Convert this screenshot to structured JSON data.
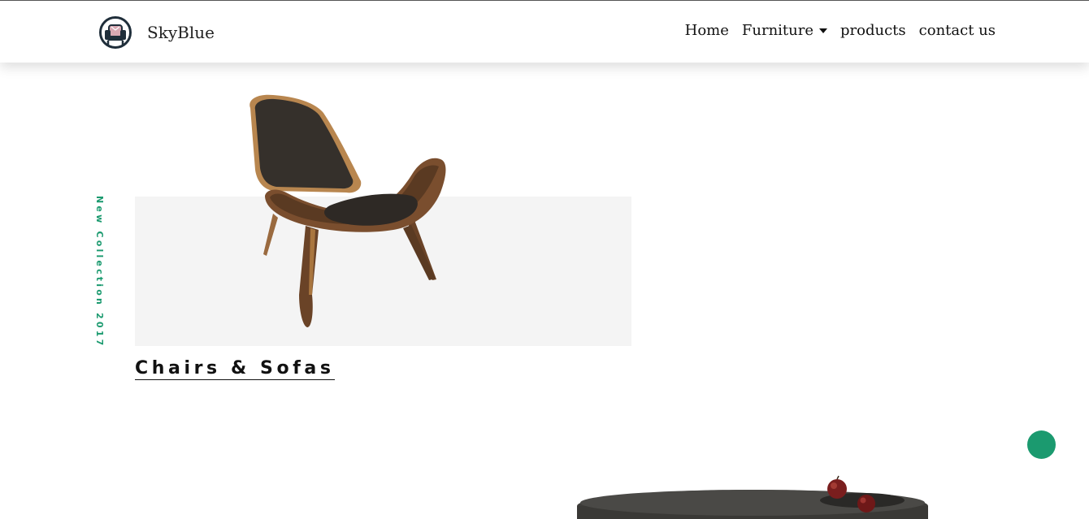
{
  "navbar": {
    "brand_name": "SkyBlue",
    "brand_icon": "armchair-logo-icon",
    "links": [
      {
        "label": "Home"
      },
      {
        "label": "Furniture",
        "has_dropdown": true
      },
      {
        "label": "products"
      },
      {
        "label": "contact us"
      }
    ]
  },
  "hero": {
    "vertical_caption": "New Collection 2017",
    "category_title": "Chairs & Sofas",
    "accent_color": "#1b9a6f"
  },
  "scroll_button": {
    "color": "#1b9a6f"
  }
}
